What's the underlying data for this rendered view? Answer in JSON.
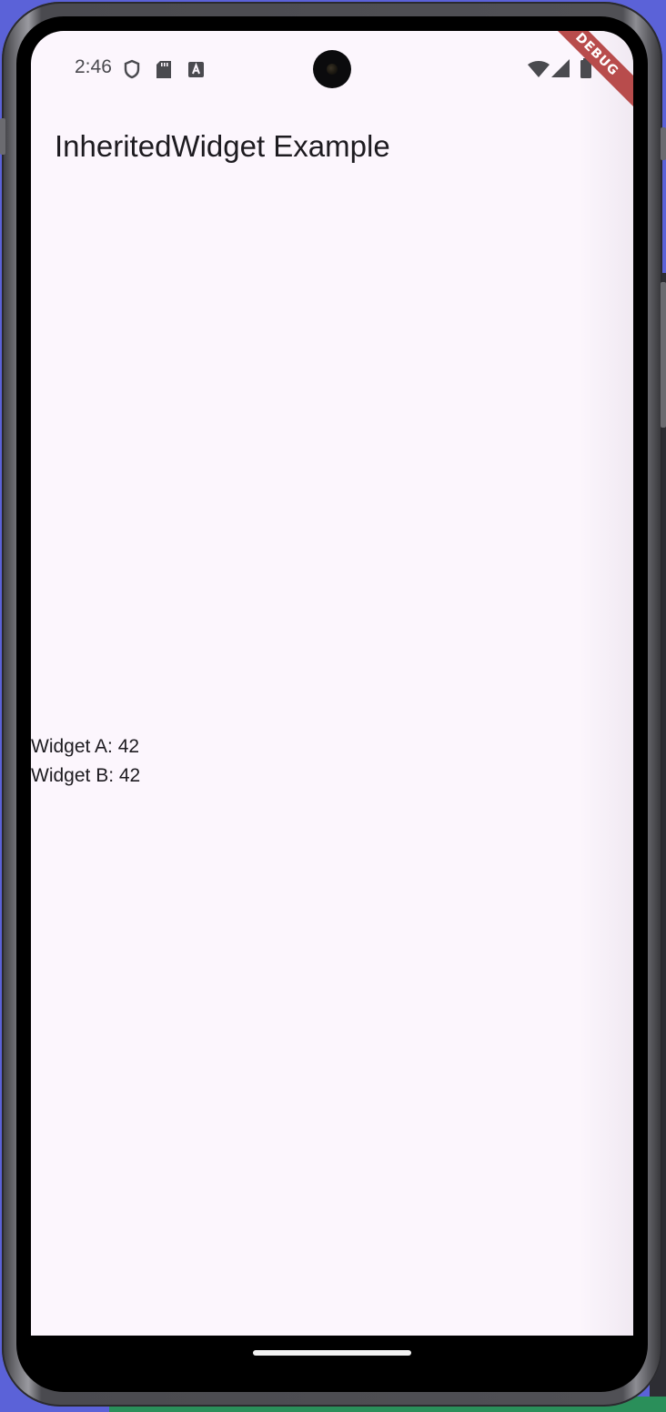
{
  "status_bar": {
    "time": "2:46",
    "left_icons": [
      "shield-icon",
      "sd-card-icon",
      "a-badge-icon"
    ],
    "right_icons": [
      "wifi-icon",
      "signal-icon",
      "battery-icon"
    ]
  },
  "debug_banner": "DEBUG",
  "app_bar": {
    "title": "InheritedWidget Example"
  },
  "body": {
    "widget_a": "Widget A: 42",
    "widget_b": "Widget B: 42"
  },
  "colors": {
    "screen_background": "#fcf6fd",
    "text": "#1d1b20",
    "debug_banner": "#b84c4c"
  }
}
